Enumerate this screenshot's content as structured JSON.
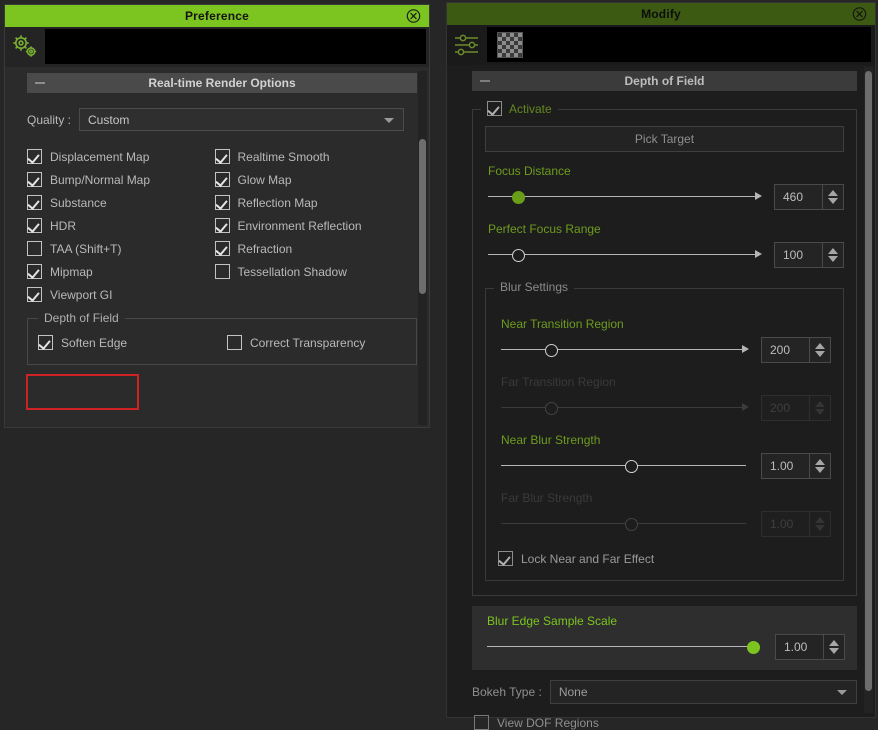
{
  "preference": {
    "title": "Preference",
    "close_icon": "close-circle-icon",
    "toolbar": {
      "icon": "render-gears-icon"
    },
    "section": {
      "title": "Real-time Render Options",
      "collapse_icon": "minus-icon"
    },
    "quality": {
      "label": "Quality :",
      "value": "Custom",
      "caret_icon": "chevron-down-icon"
    },
    "options": [
      {
        "label": "Displacement Map",
        "checked": true
      },
      {
        "label": "Realtime Smooth",
        "checked": true
      },
      {
        "label": "Bump/Normal Map",
        "checked": true
      },
      {
        "label": "Glow Map",
        "checked": true
      },
      {
        "label": "Substance",
        "checked": true
      },
      {
        "label": "Reflection Map",
        "checked": true
      },
      {
        "label": "HDR",
        "checked": true
      },
      {
        "label": "Environment Reflection",
        "checked": true
      },
      {
        "label": "TAA (Shift+T)",
        "checked": false
      },
      {
        "label": "Refraction",
        "checked": true
      },
      {
        "label": "Mipmap",
        "checked": true
      },
      {
        "label": "Tessellation Shadow",
        "checked": false
      },
      {
        "label": "Viewport GI",
        "checked": true
      }
    ],
    "dof_group": {
      "title": "Depth of Field",
      "soften_edge": {
        "label": "Soften Edge",
        "checked": true,
        "highlight_color": "#cf2222"
      },
      "correct_transparency": {
        "label": "Correct Transparency",
        "checked": false
      }
    }
  },
  "modify": {
    "title": "Modify",
    "close_icon": "close-circle-icon",
    "toolbar": {
      "sliders_icon": "sliders-icon",
      "thumbnail": "checkerboard-thumbnail"
    },
    "section": {
      "title": "Depth of Field",
      "collapse_icon": "minus-icon"
    },
    "activate": {
      "label": "Activate",
      "checked": true
    },
    "pick_target_label": "Pick Target",
    "sliders": [
      {
        "label": "Focus Distance",
        "value": "460",
        "fill": 0.12,
        "knob": "filled",
        "disabled": false,
        "arrow": true
      },
      {
        "label": "Perfect Focus Range",
        "value": "100",
        "fill": 0.12,
        "knob": "hollow",
        "disabled": false,
        "arrow": true
      }
    ],
    "blur_group": {
      "title": "Blur Settings",
      "sliders": [
        {
          "label": "Near Transition Region",
          "value": "200",
          "fill": 0.21,
          "knob": "hollow",
          "disabled": false,
          "arrow": true
        },
        {
          "label": "Far Transition Region",
          "value": "200",
          "fill": 0.21,
          "knob": "hollow",
          "disabled": true,
          "arrow": true
        },
        {
          "label": "Near Blur Strength",
          "value": "1.00",
          "fill": 0.53,
          "knob": "hollow",
          "disabled": false,
          "arrow": false
        },
        {
          "label": "Far Blur Strength",
          "value": "1.00",
          "fill": 0.53,
          "knob": "hollow",
          "disabled": true,
          "arrow": false
        }
      ],
      "lock": {
        "label": "Lock Near and Far Effect",
        "checked": true
      }
    },
    "blur_edge": {
      "label": "Blur Edge Sample Scale",
      "value": "1.00",
      "fill": 0.98,
      "accent": "#7cc41f"
    },
    "bokeh": {
      "label": "Bokeh Type :",
      "value": "None",
      "caret_icon": "chevron-down-icon"
    },
    "view_dof": {
      "label": "View DOF Regions",
      "checked": false
    }
  },
  "colors": {
    "title_focused": "#7cc41f",
    "title_unfocused": "#3c5a11",
    "accent_green": "#7cc41f",
    "label_green": "#6e9c1f",
    "annotation_red": "#cf2222"
  }
}
